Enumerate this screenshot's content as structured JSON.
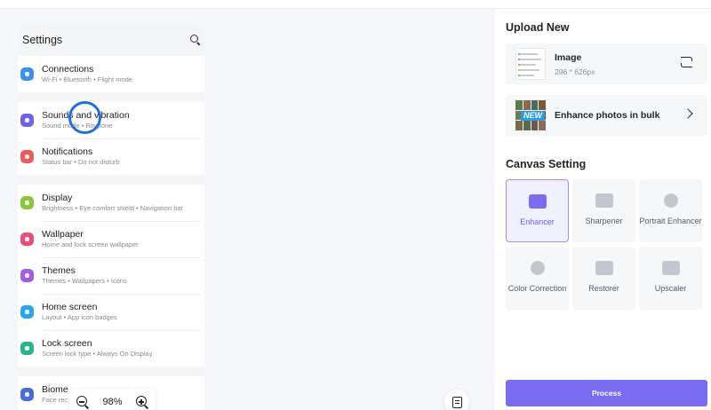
{
  "canvas": {
    "zoom_level": "98%",
    "phone": {
      "title": "Settings",
      "groups": [
        [
          {
            "name": "Connections",
            "sub": "Wi-Fi • Bluetooth • Flight mode",
            "color": "#3d8ff2"
          }
        ],
        [
          {
            "name": "Sounds and vibration",
            "sub": "Sound mode • Ringtone",
            "color": "#6f63e8"
          },
          {
            "name": "Notifications",
            "sub": "Status bar • Do not disturb",
            "color": "#ef5a5a"
          }
        ],
        [
          {
            "name": "Display",
            "sub": "Brightness • Eye comfort shield • Navigation bar",
            "color": "#8cc63f"
          },
          {
            "name": "Wallpaper",
            "sub": "Home and lock screen wallpaper",
            "color": "#ea4f7a"
          },
          {
            "name": "Themes",
            "sub": "Themes • Wallpapers • Icons",
            "color": "#a15ee0"
          },
          {
            "name": "Home screen",
            "sub": "Layout • App icon badges",
            "color": "#2aa6e8"
          },
          {
            "name": "Lock screen",
            "sub": "Screen lock type • Always On Display",
            "color": "#2bb38a"
          }
        ],
        [
          {
            "name": "Biome",
            "sub": "Face rec",
            "color": "#4a6bdc"
          }
        ]
      ]
    }
  },
  "panel": {
    "upload_title": "Upload New",
    "image_card": {
      "title": "Image",
      "dimensions": "296 * 626px"
    },
    "bulk_card": {
      "badge": "NEW",
      "title": "Enhance photos in bulk"
    },
    "canvas_setting_title": "Canvas Setting",
    "tools": [
      {
        "label": "Enhancer",
        "icon": "ai-image-icon",
        "active": true
      },
      {
        "label": "Sharpener",
        "icon": "hd-image-icon",
        "active": false
      },
      {
        "label": "Portrait Enhancer",
        "icon": "portrait-icon",
        "active": false
      },
      {
        "label": "Color Correction",
        "icon": "color-circles-icon",
        "active": false
      },
      {
        "label": "Restorer",
        "icon": "bandage-icon",
        "active": false
      },
      {
        "label": "Upscaler",
        "icon": "expand-icon",
        "active": false
      }
    ],
    "process_label": "Process"
  }
}
